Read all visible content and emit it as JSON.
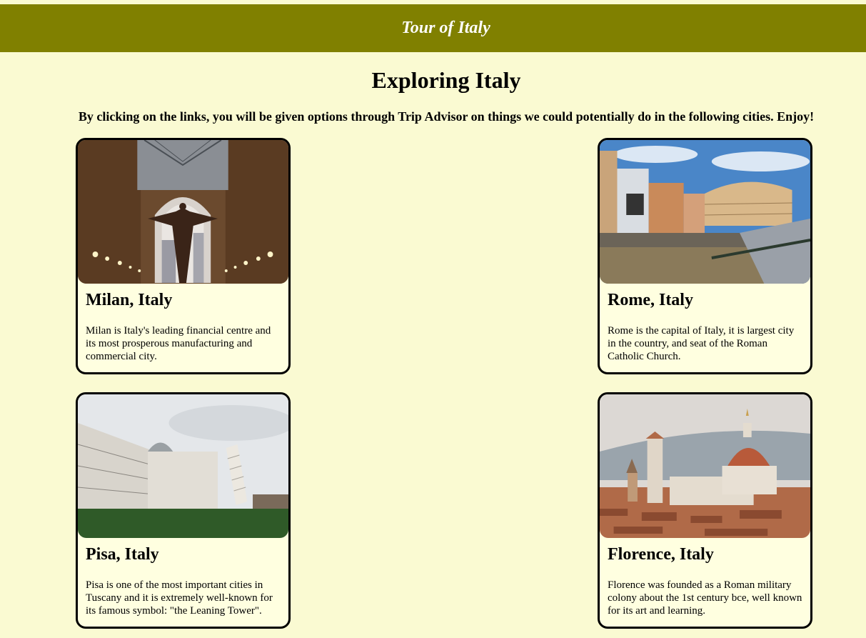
{
  "header": {
    "banner_title": "Tour of Italy"
  },
  "main": {
    "page_title": "Exploring Italy",
    "intro": "By clicking on the links, you will be given options through Trip Advisor on things we could potentially do in the following cities. Enjoy!"
  },
  "cards": [
    {
      "title": "Milan, Italy",
      "description": "Milan is Italy's leading financial centre and its most prosperous manufacturing and commercial city."
    },
    {
      "title": "Rome, Italy",
      "description": "Rome is the capital of Italy, it is largest city in the country, and seat of the Roman Catholic Church."
    },
    {
      "title": "Pisa, Italy",
      "description": "Pisa is one of the most important cities in Tuscany and it is extremely well-known for its famous symbol: \"the Leaning Tower\"."
    },
    {
      "title": "Florence, Italy",
      "description": "Florence was founded as a Roman military colony about the 1st century bce, well known for its art and learning."
    }
  ],
  "colors": {
    "page_background": "#fafad2",
    "banner_background": "#808000",
    "card_background": "#ffffe0"
  }
}
